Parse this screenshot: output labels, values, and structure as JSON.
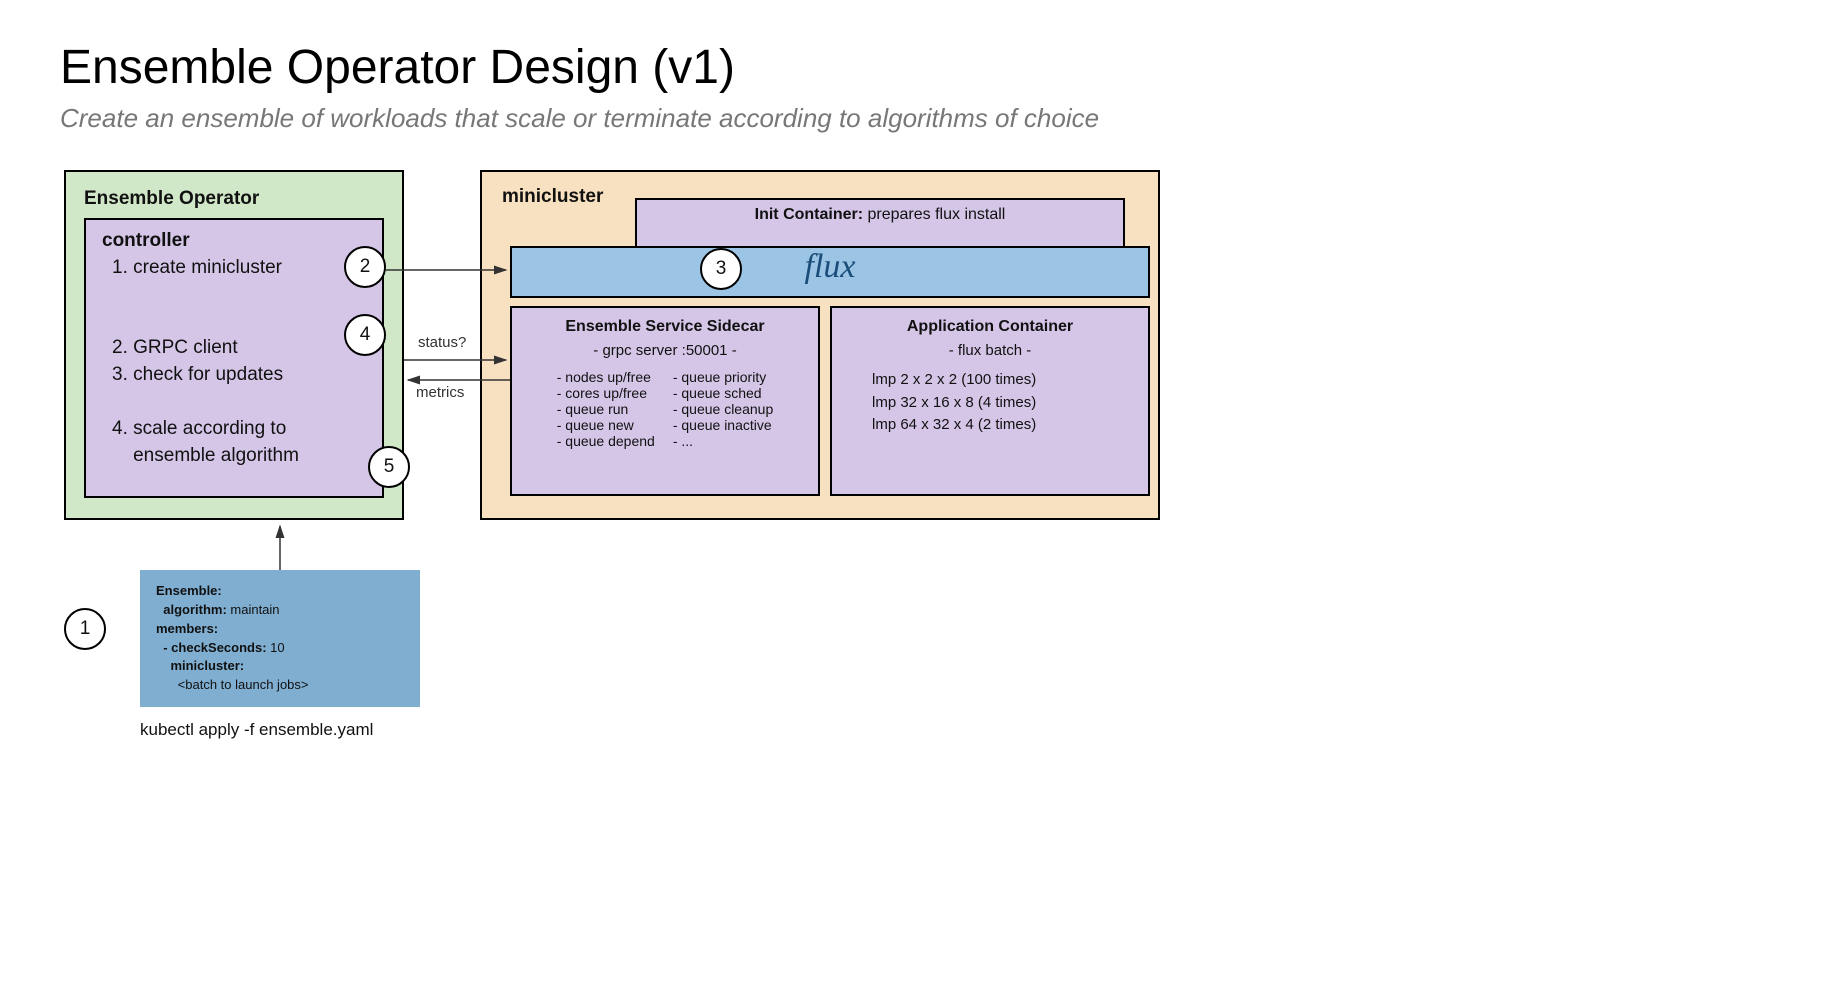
{
  "title": "Ensemble Operator Design (v1)",
  "subtitle": "Create an ensemble of workloads that scale or terminate according to algorithms of choice",
  "operator": {
    "title": "Ensemble Operator",
    "controller": {
      "title": "controller",
      "items": {
        "i1": "1. create minicluster",
        "i2": "2. GRPC client",
        "i3": "3. check for updates",
        "i4": "4. scale according to",
        "i4b": "    ensemble algorithm"
      }
    }
  },
  "minicluster": {
    "title": "minicluster",
    "init": {
      "label": "Init Container:",
      "desc": " prepares flux install"
    },
    "flux": "flux",
    "sidecar": {
      "title": "Ensemble Service Sidecar",
      "sub": "- grpc server :50001 -",
      "col1": {
        "a": "- nodes up/free",
        "b": "- cores up/free",
        "c": "- queue run",
        "d": "- queue new",
        "e": "- queue depend"
      },
      "col2": {
        "a": "- queue priority",
        "b": "- queue sched",
        "c": "- queue cleanup",
        "d": "- queue inactive",
        "e": "- ..."
      }
    },
    "app": {
      "title": "Application Container",
      "sub": "- flux batch -",
      "lines": {
        "a": "lmp 2 x 2 x 2 (100 times)",
        "b": "lmp 32 x 16 x 8 (4 times)",
        "c": "lmp 64 x 32 x 4 (2 times)"
      }
    }
  },
  "arrows": {
    "status": "status?",
    "metrics": "metrics"
  },
  "yaml": {
    "l1k": "Ensemble:",
    "l2k": "  algorithm:",
    "l2v": " maintain",
    "l3k": "members:",
    "l4k": "  - checkSeconds:",
    "l4v": " 10",
    "l5k": "    minicluster:",
    "l6": "      <batch to launch jobs>"
  },
  "kubectl": "kubectl apply -f ensemble.yaml",
  "badges": {
    "b1": "1",
    "b2": "2",
    "b3": "3",
    "b4": "4",
    "b5": "5"
  }
}
